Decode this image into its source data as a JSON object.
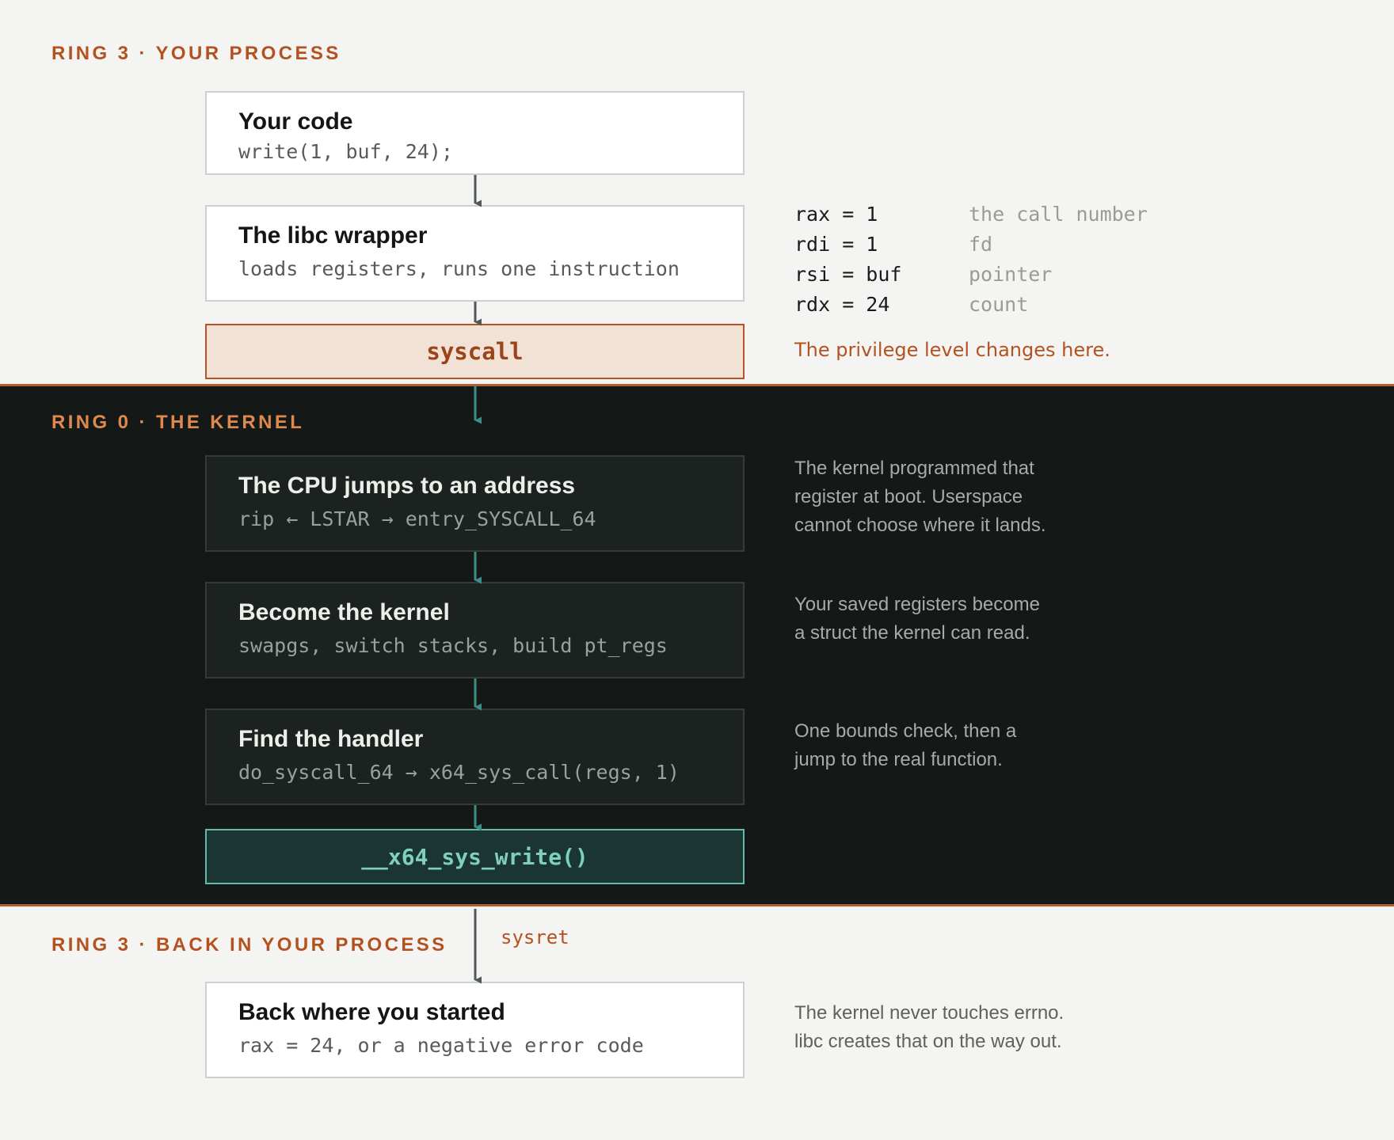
{
  "ring3_top": {
    "label": "RING 3 · YOUR PROCESS"
  },
  "step_code": {
    "title": "Your code",
    "detail": "write(1, buf, 24);"
  },
  "step_libc": {
    "title": "The libc wrapper",
    "detail": "loads registers, runs one instruction"
  },
  "syscall_box": {
    "label": "syscall"
  },
  "registers": [
    {
      "assign": "rax = 1",
      "desc": "the call number"
    },
    {
      "assign": "rdi = 1",
      "desc": "fd"
    },
    {
      "assign": "rsi = buf",
      "desc": "pointer"
    },
    {
      "assign": "rdx = 24",
      "desc": "count"
    }
  ],
  "privilege_note": "The privilege level changes here.",
  "ring0": {
    "label": "RING 0 · THE KERNEL"
  },
  "step_jump": {
    "title": "The CPU jumps to an address",
    "detail": "rip ← LSTAR → entry_SYSCALL_64",
    "note": [
      "The kernel programmed that",
      "register at boot. Userspace",
      "cannot choose where it lands."
    ]
  },
  "step_become": {
    "title": "Become the kernel",
    "detail": "swapgs, switch stacks, build pt_regs",
    "note": [
      "Your saved registers become",
      "a struct the kernel can read."
    ]
  },
  "step_find": {
    "title": "Find the handler",
    "detail": "do_syscall_64 → x64_sys_call(regs, 1)",
    "note": [
      "One bounds check, then a",
      "jump to the real function."
    ]
  },
  "handler_box": {
    "label": "__x64_sys_write()"
  },
  "ring3_bottom": {
    "label": "RING 3 · BACK IN YOUR PROCESS"
  },
  "sysret_label": "sysret",
  "step_back": {
    "title": "Back where you started",
    "detail": "rax = 24, or a negative error code",
    "note": [
      "The kernel never touches errno.",
      "libc creates that on the way out."
    ]
  },
  "colors": {
    "accent_orange": "#b3521f",
    "kernel_bg": "#141816",
    "teal": "#67b8ab",
    "user_bg": "#f4f4f2"
  }
}
